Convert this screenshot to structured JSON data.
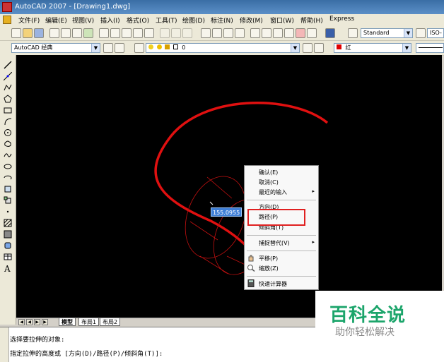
{
  "window": {
    "title": "AutoCAD 2007 - [Drawing1.dwg]"
  },
  "menubar": {
    "items": [
      "文件(F)",
      "编辑(E)",
      "视图(V)",
      "插入(I)",
      "格式(O)",
      "工具(T)",
      "绘图(D)",
      "标注(N)",
      "修改(M)",
      "窗口(W)",
      "帮助(H)",
      "Express"
    ]
  },
  "toolbar": {
    "text_style": "Standard",
    "dim_style": "ISO-"
  },
  "workspace_bar": {
    "workspace": "AutoCAD 经典",
    "layer": "0",
    "color": "红"
  },
  "canvas": {
    "dynamic_input_value": "155.0955",
    "curve_color": "#e01010"
  },
  "context_menu": {
    "items": [
      {
        "label": "确认(E)"
      },
      {
        "label": "取消(C)"
      },
      {
        "label": "最近的输入",
        "submenu": "▸"
      },
      {
        "label": "方向(D)"
      },
      {
        "label": "路径(P)"
      },
      {
        "label": "倾斜角(T)"
      },
      {
        "label": "捕捉替代(V)",
        "submenu": "▸"
      },
      {
        "label": "平移(P)"
      },
      {
        "label": "缩放(Z)"
      },
      {
        "label": "快速计算器"
      }
    ]
  },
  "tabs": [
    "模型",
    "布局1",
    "布局2"
  ],
  "command_line": {
    "lines": [
      "选择要拉伸的对象:",
      "指定拉伸的高度或 [方向(D)/路径(P)/倾斜角(T)]:"
    ]
  },
  "watermark": {
    "title": "百科全说",
    "subtitle": "助你轻松解决"
  }
}
